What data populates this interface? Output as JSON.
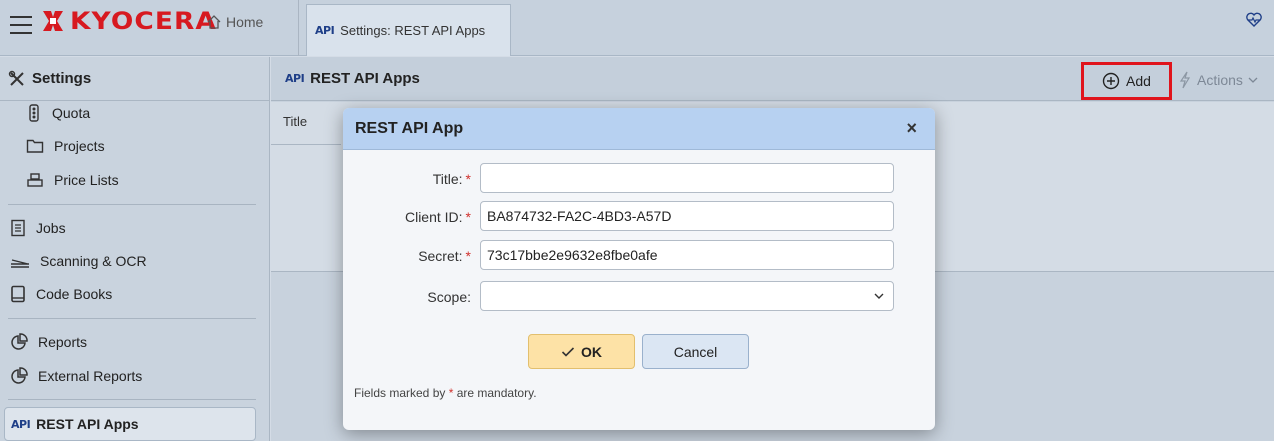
{
  "topbar": {
    "brand": "KYOCERA",
    "home_tab": "Home",
    "active_tab": {
      "badge": "API",
      "label": "Settings: REST API Apps"
    }
  },
  "sidebar": {
    "title": "Settings",
    "items": [
      {
        "label": "Quota",
        "icon": "traffic-light-icon"
      },
      {
        "label": "Projects",
        "icon": "folder-icon"
      },
      {
        "label": "Price Lists",
        "icon": "cash-register-icon"
      },
      {
        "label": "Jobs",
        "icon": "document-icon"
      },
      {
        "label": "Scanning & OCR",
        "icon": "scanner-icon"
      },
      {
        "label": "Code Books",
        "icon": "book-icon"
      },
      {
        "label": "Reports",
        "icon": "pie-chart-icon"
      },
      {
        "label": "External Reports",
        "icon": "pie-chart-icon"
      }
    ],
    "active_item": {
      "badge": "API",
      "label": "REST API Apps"
    }
  },
  "main": {
    "badge": "API",
    "title": "REST API Apps",
    "add_label": "Add",
    "actions_label": "Actions",
    "column_title": "Title"
  },
  "modal": {
    "title": "REST API App",
    "close": "×",
    "fields": {
      "title": {
        "label": "Title:",
        "value": ""
      },
      "client_id": {
        "label": "Client ID:",
        "value": "BA874732-FA2C-4BD3-A57D"
      },
      "secret": {
        "label": "Secret:",
        "value": "73c17bbe2e9632e8fbe0afe"
      },
      "scope": {
        "label": "Scope:",
        "value": ""
      }
    },
    "required_mark": "*",
    "ok_label": "OK",
    "cancel_label": "Cancel",
    "note_prefix": "Fields marked by ",
    "note_suffix": " are mandatory."
  },
  "colors": {
    "brand_red": "#d71920",
    "highlight_red": "#e0141c",
    "modal_header": "#b7d1f1",
    "ok_button": "#fde2a6"
  }
}
